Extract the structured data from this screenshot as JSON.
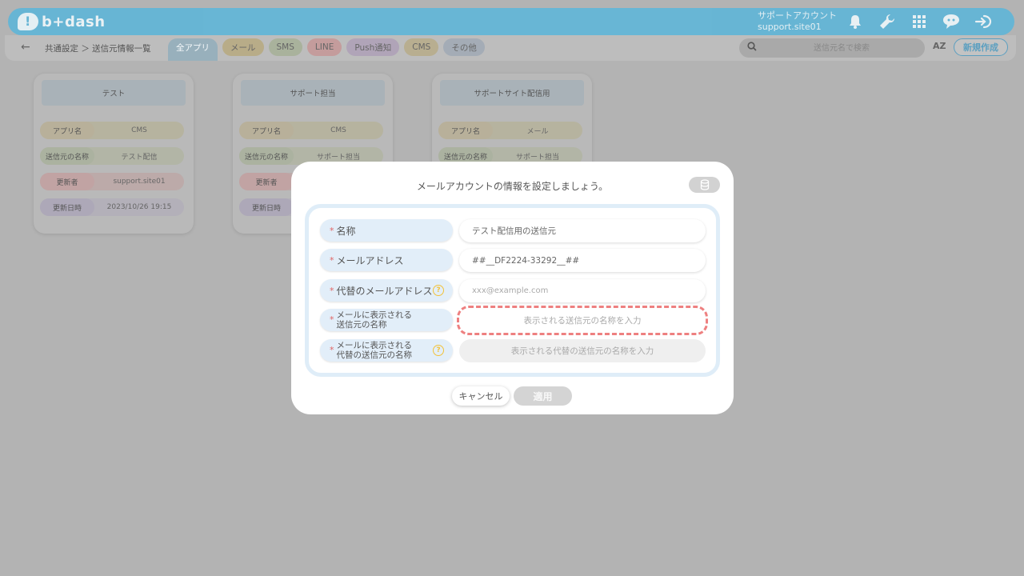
{
  "header": {
    "logo_text": "b+dash",
    "account_name": "サポートアカウント",
    "account_id": "support.site01",
    "icons": [
      "bell-icon",
      "wrench-icon",
      "apps-grid-icon",
      "chat-bot-icon",
      "logout-icon"
    ]
  },
  "subbar": {
    "breadcrumb": "共通設定 ＞ 送信元情報一覧",
    "tabs": [
      {
        "label": "全アプリ",
        "color": "#98b0bc"
      },
      {
        "label": "メール",
        "color": "#b8ac88"
      },
      {
        "label": "SMS",
        "color": "#a9b29c"
      },
      {
        "label": "LINE",
        "color": "#c49c9c"
      },
      {
        "label": "Push通知",
        "color": "#b0a4b8"
      },
      {
        "label": "CMS",
        "color": "#b8ae90"
      },
      {
        "label": "その他",
        "color": "#a4acb6"
      }
    ],
    "search_placeholder": "送信元名で検索",
    "sort_label": "AZ",
    "new_button": "新規作成"
  },
  "cards": [
    {
      "title": "テスト",
      "rows": [
        {
          "key": "アプリ名",
          "value": "CMS"
        },
        {
          "key": "送信元の名称",
          "value": "テスト配信"
        },
        {
          "key": "更新者",
          "value": "support.site01"
        },
        {
          "key": "更新日時",
          "value": "2023/10/26 19:15"
        }
      ]
    },
    {
      "title": "サポート担当",
      "rows": [
        {
          "key": "アプリ名",
          "value": "CMS"
        },
        {
          "key": "送信元の名称",
          "value": "サポート担当"
        },
        {
          "key": "更新者",
          "value": ""
        },
        {
          "key": "更新日時",
          "value": ""
        }
      ]
    },
    {
      "title": "サポートサイト配信用",
      "rows": [
        {
          "key": "アプリ名",
          "value": "メール"
        },
        {
          "key": "送信元の名称",
          "value": "サポート担当"
        }
      ]
    }
  ],
  "card_key_colors": [
    "#b8b09a",
    "#abb2a0",
    "#c1a3a3",
    "#ada8b8"
  ],
  "modal": {
    "title": "メールアカウントの情報を設定しましょう。",
    "fields": [
      {
        "label": "名称",
        "value": "テスト配信用の送信元",
        "placeholder": ""
      },
      {
        "label": "メールアドレス",
        "value": "##__DF2224-33292__##",
        "placeholder": ""
      },
      {
        "label": "代替のメールアドレス",
        "value": "",
        "placeholder": "xxx@example.com"
      },
      {
        "label_line1": "メールに表示される",
        "label_line2": "送信元の名称",
        "value": "",
        "placeholder": "表示される送信元の名称を入力"
      },
      {
        "label_line1": "メールに表示される",
        "label_line2": "代替の送信元の名称",
        "value": "",
        "placeholder": "表示される代替の送信元の名称を入力"
      }
    ],
    "required_mark": "*",
    "help_mark": "?",
    "cancel_label": "キャンセル",
    "apply_label": "適用"
  }
}
